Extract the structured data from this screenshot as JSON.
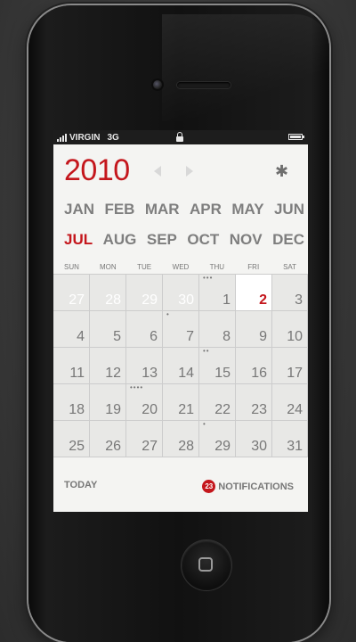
{
  "status_bar": {
    "carrier": "VIRGIN",
    "network": "3G"
  },
  "calendar": {
    "year": "2010",
    "months_row1": [
      "JAN",
      "FEB",
      "MAR",
      "APR",
      "MAY",
      "JUN"
    ],
    "months_row2": [
      "JUL",
      "AUG",
      "SEP",
      "OCT",
      "NOV",
      "DEC"
    ],
    "selected_month": "JUL",
    "weekdays": [
      "SUN",
      "MON",
      "TUE",
      "WED",
      "THU",
      "FRI",
      "SAT"
    ],
    "weeks": [
      [
        {
          "day": "27",
          "other": true
        },
        {
          "day": "28",
          "other": true
        },
        {
          "day": "29",
          "other": true
        },
        {
          "day": "30",
          "other": true
        },
        {
          "day": "1",
          "dots": "•••"
        },
        {
          "day": "2",
          "today": true
        },
        {
          "day": "3"
        }
      ],
      [
        {
          "day": "4"
        },
        {
          "day": "5"
        },
        {
          "day": "6"
        },
        {
          "day": "7",
          "dots": "•"
        },
        {
          "day": "8"
        },
        {
          "day": "9"
        },
        {
          "day": "10"
        }
      ],
      [
        {
          "day": "11"
        },
        {
          "day": "12"
        },
        {
          "day": "13"
        },
        {
          "day": "14"
        },
        {
          "day": "15",
          "dots": "••"
        },
        {
          "day": "16"
        },
        {
          "day": "17"
        }
      ],
      [
        {
          "day": "18"
        },
        {
          "day": "19"
        },
        {
          "day": "20",
          "dots": "••••"
        },
        {
          "day": "21"
        },
        {
          "day": "22"
        },
        {
          "day": "23"
        },
        {
          "day": "24"
        }
      ],
      [
        {
          "day": "25"
        },
        {
          "day": "26"
        },
        {
          "day": "27"
        },
        {
          "day": "28"
        },
        {
          "day": "29",
          "dots": "•"
        },
        {
          "day": "30"
        },
        {
          "day": "31"
        }
      ]
    ]
  },
  "footer": {
    "today_label": "TODAY",
    "notifications_count": "23",
    "notifications_label": "NOTIFICATIONS"
  },
  "icons": {
    "prev": "chevron-left-icon",
    "next": "chevron-right-icon",
    "settings": "gear-icon"
  },
  "colors": {
    "accent": "#c4161c",
    "text_gray": "#7e7e7e",
    "cell_bg": "#e8e8e6",
    "screen_bg": "#f4f4f2"
  }
}
